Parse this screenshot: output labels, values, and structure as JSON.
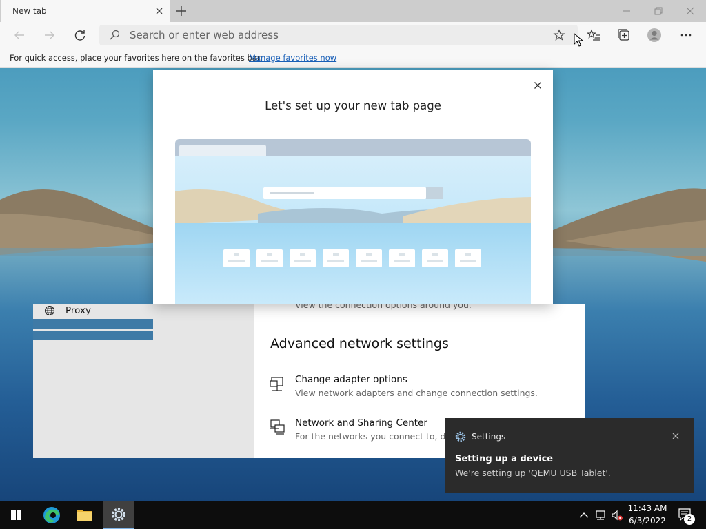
{
  "browser": {
    "tab_title": "New tab",
    "address_placeholder": "Search or enter web address",
    "favorites_bar": {
      "message": "For quick access, place your favorites here on the favorites bar.",
      "link": "Manage favorites now"
    }
  },
  "dialog": {
    "title": "Let's set up your new tab page"
  },
  "settings": {
    "sidebar_item": "Proxy",
    "cut_off_text": "View the connection options around you.",
    "section_title": "Advanced network settings",
    "options": [
      {
        "title": "Change adapter options",
        "desc": "View network adapters and change connection settings."
      },
      {
        "title": "Network and Sharing Center",
        "desc": "For the networks you connect to, decide what you want to share."
      }
    ]
  },
  "toast": {
    "app": "Settings",
    "title": "Setting up a device",
    "body": "We're setting up 'QEMU USB Tablet'."
  },
  "taskbar": {
    "time": "11:43 AM",
    "date": "6/3/2022",
    "notification_count": "2"
  },
  "colors": {
    "accent": "#1a60b8",
    "taskbar": "#0d0d0d",
    "toast": "#2b2b2b"
  }
}
